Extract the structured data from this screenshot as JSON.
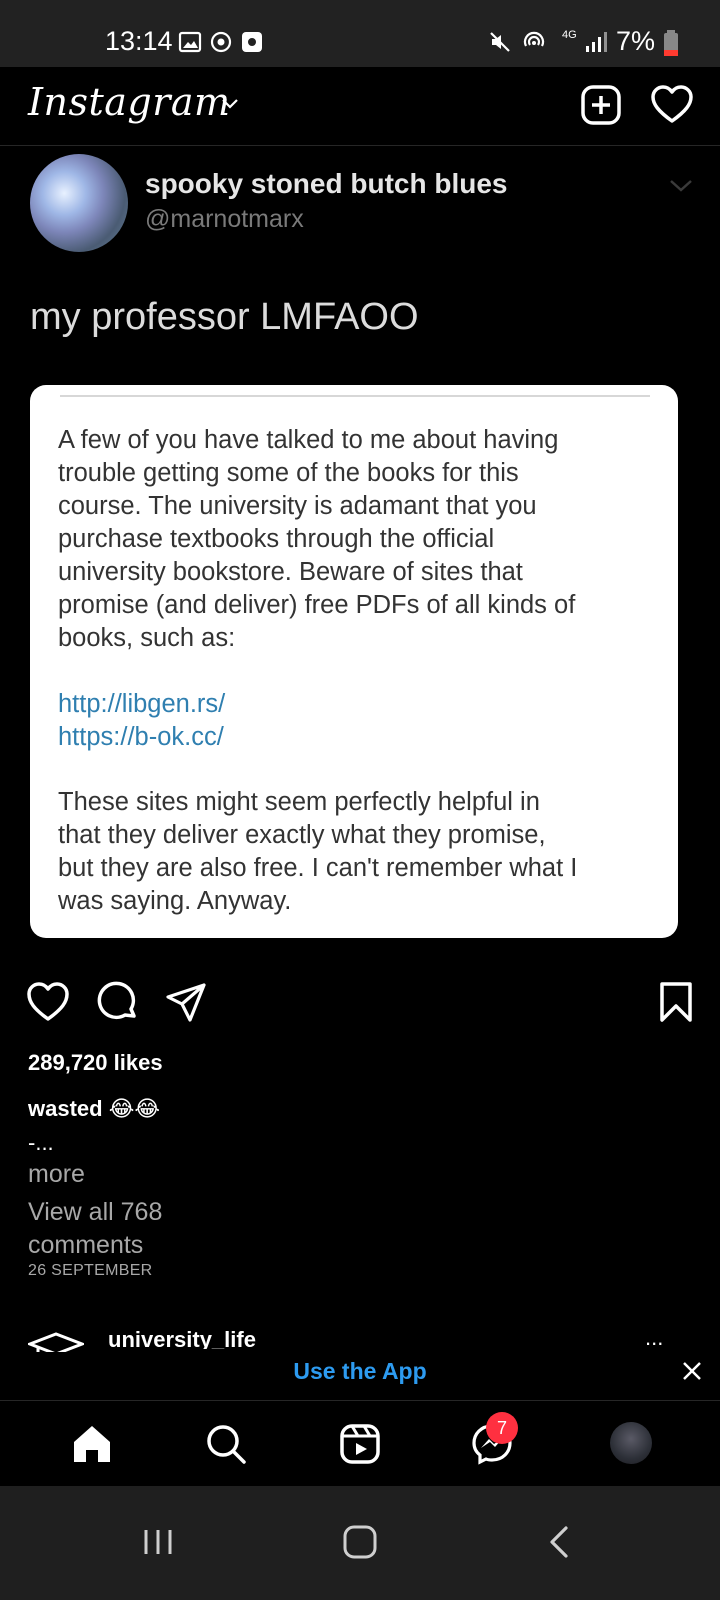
{
  "status_bar": {
    "time": "13:14",
    "battery": "7%",
    "network": "4G"
  },
  "header": {
    "logo_text": "Instagram",
    "dropdown_icon": "chevron-down-icon",
    "new_post_icon": "plus-square-icon",
    "activity_icon": "heart-icon"
  },
  "post": {
    "tweet": {
      "display_name": "spooky stoned butch blues",
      "handle": "@marnotmarx",
      "text": "my professor LMFAOO",
      "note": {
        "para1_lines": [
          "A few of you have talked to me about having",
          "trouble getting some of the books for this",
          "course. The university is adamant that you",
          "purchase textbooks through the official",
          "university bookstore. Beware of sites that",
          "promise (and deliver) free PDFs of all kinds of",
          "books, such as:"
        ],
        "links": [
          "http://libgen.rs/",
          "https://b-ok.cc/"
        ],
        "para2_lines": [
          "These sites might seem perfectly helpful in",
          "that they deliver exactly what they promise,",
          "but they are also free. I can't remember what I",
          "was saying. Anyway."
        ]
      }
    },
    "likes": "289,720 likes",
    "caption_user": "wasted",
    "caption_emoji": "😂😂",
    "caption_continuation": "-...",
    "more_label": "more",
    "view_comments": "View all 768 comments",
    "date": "26 SEPTEMBER"
  },
  "next_post": {
    "username": "university_life",
    "menu": "..."
  },
  "banner": {
    "cta": "Use the App"
  },
  "bottom_nav": {
    "messages_badge": "7"
  },
  "colors": {
    "link_blue": "#2d9bf0",
    "badge_red": "#ff3040"
  }
}
